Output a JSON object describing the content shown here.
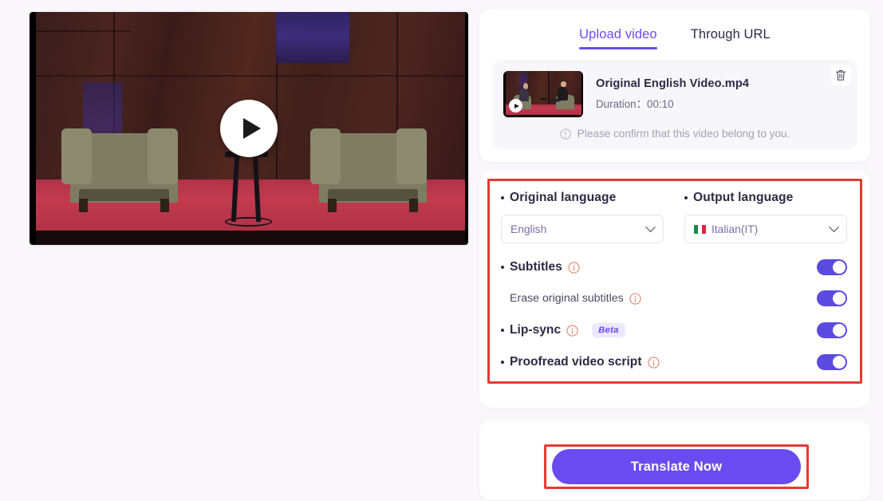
{
  "video_preview": {
    "name": "video-preview-player",
    "play_icon": "play-icon",
    "scene_description": "TED stage interview, two seated men in armchairs"
  },
  "panel": {
    "tabs": [
      {
        "label": "Upload video",
        "active": true
      },
      {
        "label": "Through URL",
        "active": false
      }
    ],
    "file": {
      "name": "Original English Video.mp4",
      "duration_label": "Duration：",
      "duration_value": "00:10",
      "delete_icon": "trash-icon",
      "thumb_play_icon": "play-icon"
    },
    "confirm_notice": {
      "icon": "info-circle-icon",
      "text": "Please confirm that this video belong to you."
    }
  },
  "settings": {
    "original_language": {
      "label": "Original language",
      "value": "English",
      "chevron": "chevron-down-icon"
    },
    "output_language": {
      "label": "Output language",
      "value": "Italian(IT)",
      "flag": "italy-flag-icon",
      "chevron": "chevron-down-icon"
    },
    "options": [
      {
        "label": "Subtitles",
        "info_icon": "info-circle-icon",
        "enabled": true,
        "badge": null,
        "sub": false
      },
      {
        "label": "Erase original subtitles",
        "info_icon": "info-circle-icon",
        "enabled": true,
        "badge": null,
        "sub": true
      },
      {
        "label": "Lip-sync",
        "info_icon": "info-circle-icon",
        "enabled": true,
        "badge": "Beta",
        "sub": false
      },
      {
        "label": "Proofread video script",
        "info_icon": "info-circle-icon",
        "enabled": true,
        "badge": null,
        "sub": false
      }
    ]
  },
  "action": {
    "translate_label": "Translate Now"
  },
  "colors": {
    "accent_purple": "#6a4bf0",
    "toggle_on": "#5b4ae0",
    "annotation_red": "#e33b33",
    "page_background": "#faf7fb",
    "text_dark": "#2b2b45",
    "info_icon": "#e08878",
    "badge_bg": "#ece8fd"
  }
}
